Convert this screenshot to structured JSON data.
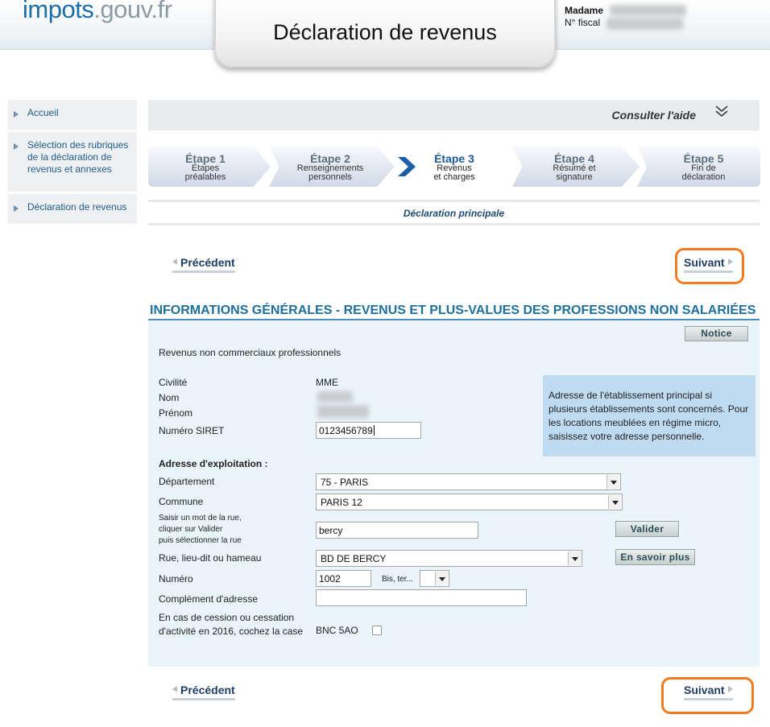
{
  "header": {
    "logo_part1": "impots",
    "logo_part2": ".gouv.",
    "logo_part3": "fr",
    "page_title": "Déclaration de revenus",
    "user_label": "Madame",
    "fiscal_label": "N° fiscal"
  },
  "sidebar": {
    "items": [
      {
        "label": "Accueil"
      },
      {
        "label": "Sélection des rubriques de la déclaration de revenus et annexes"
      },
      {
        "label": "Déclaration de revenus"
      }
    ]
  },
  "helpbar": {
    "help_label": "Consulter l'aide",
    "toggle_icon": "double-chevron-down-icon"
  },
  "steps": [
    {
      "title": "Étape 1",
      "desc1": "Étapes",
      "desc2": "préalables"
    },
    {
      "title": "Étape 2",
      "desc1": "Renseignements",
      "desc2": "personnels"
    },
    {
      "title": "Étape 3",
      "desc1": "Revenus",
      "desc2": "et charges",
      "current": true
    },
    {
      "title": "Étape 4",
      "desc1": "Résumé et",
      "desc2": "signature"
    },
    {
      "title": "Étape 5",
      "desc1": "Fin de",
      "desc2": "déclaration"
    }
  ],
  "subheader": "Déclaration principale",
  "nav": {
    "prev_label": "Précédent",
    "next_label": "Suivant",
    "highlight_color": "#f07c22"
  },
  "section": {
    "title": "INFORMATIONS GÉNÉRALES - REVENUS ET PLUS-VALUES DES PROFESSIONS NON SALARIÉES",
    "notice_label": "Notice",
    "subtitle": "Revenus non commerciaux professionnels",
    "civilite_label": "Civilité",
    "civilite_value": "MME",
    "nom_label": "Nom",
    "prenom_label": "Prénom",
    "siret_label": "Numéro SIRET",
    "siret_value": "0123456789",
    "info_text": "Adresse de l'établissement principal si plusieurs établissements sont concernés. Pour les locations meublées en régime micro, saisissez votre adresse personnelle.",
    "address_heading": "Adresse d'exploitation :",
    "departement_label": "Département",
    "departement_value": "75 - PARIS",
    "commune_label": "Commune",
    "commune_value": "PARIS 12",
    "street_search_label_1": "Saisir un mot de la rue,",
    "street_search_label_2": "cliquer sur Valider",
    "street_search_label_3": "puis sélectionner la rue",
    "street_search_value": "bercy",
    "valider_label": "Valider",
    "rue_label": "Rue, lieu-dit ou hameau",
    "rue_value": "BD DE BERCY",
    "en_savoir_plus_label": "En savoir plus",
    "numero_label": "Numéro",
    "numero_value": "1002",
    "bis_label": "Bis, ter...",
    "complement_label": "Complément d'adresse",
    "complement_value": "",
    "cession_label": "En cas de cession ou cessation d'activité en 2016, cochez la case",
    "cession_code": "BNC 5AO",
    "cession_checked": false
  },
  "colors": {
    "accent_blue": "#1f6f9d",
    "panel_bg": "#eaf4fb",
    "info_bg": "#bfdbf1"
  }
}
